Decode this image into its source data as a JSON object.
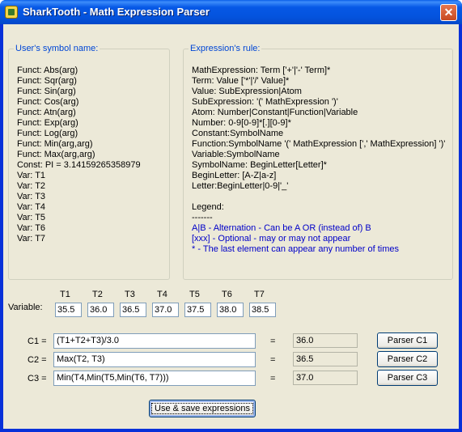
{
  "window": {
    "title": "SharkTooth - Math Expression Parser",
    "close_label": "✕"
  },
  "symbols": {
    "legend": "User's symbol name:",
    "lines": [
      "Funct: Abs(arg)",
      "Funct: Sqr(arg)",
      "Funct: Sin(arg)",
      "Funct: Cos(arg)",
      "Funct: Atn(arg)",
      "Funct: Exp(arg)",
      "Funct: Log(arg)",
      "Funct: Min(arg,arg)",
      "Funct: Max(arg,arg)",
      "Const: PI = 3.14159265358979",
      "Var: T1",
      "Var: T2",
      "Var: T3",
      "Var: T4",
      "Var: T5",
      "Var: T6",
      "Var: T7"
    ]
  },
  "rules": {
    "legend": "Expression's rule:",
    "lines": [
      "MathExpression: Term ['+'|'-' Term]*",
      "Term: Value ['*'|'/' Value]*",
      "Value: SubExpression|Atom",
      "SubExpression: '(' MathExpression ')'",
      "Atom: Number|Constant|Function|Variable",
      "Number: 0-9[0-9]*[.][0-9]*",
      "Constant:SymbolName",
      "Function:SymbolName '(' MathExpression [',' MathExpression] ')'",
      "Variable:SymbolName",
      "SymbolName: BeginLetter[Letter]*",
      "BeginLetter: [A-Z|a-z]",
      "Letter:BeginLetter|0-9|'_'",
      "",
      "Legend:",
      "-------",
      "A|B - Alternation - Can be A OR (instead of) B",
      "[xxx] - Optional - may or may not appear",
      "* - The last element can appear any number of times"
    ]
  },
  "variables": {
    "label": "Variable:",
    "items": [
      {
        "name": "T1",
        "value": "35.5"
      },
      {
        "name": "T2",
        "value": "36.0"
      },
      {
        "name": "T3",
        "value": "36.5"
      },
      {
        "name": "T4",
        "value": "37.0"
      },
      {
        "name": "T5",
        "value": "37.5"
      },
      {
        "name": "T6",
        "value": "38.0"
      },
      {
        "name": "T7",
        "value": "38.5"
      }
    ]
  },
  "expressions": [
    {
      "label": "C1 =",
      "expression": "(T1+T2+T3)/3.0",
      "equals": "=",
      "result": "36.0",
      "button": "Parser C1"
    },
    {
      "label": "C2 =",
      "expression": "Max(T2, T3)",
      "equals": "=",
      "result": "36.5",
      "button": "Parser C2"
    },
    {
      "label": "C3 =",
      "expression": "Min(T4,Min(T5,Min(T6, T7)))",
      "equals": "=",
      "result": "37.0",
      "button": "Parser C3"
    }
  ],
  "save_button": "Use & save expressions"
}
